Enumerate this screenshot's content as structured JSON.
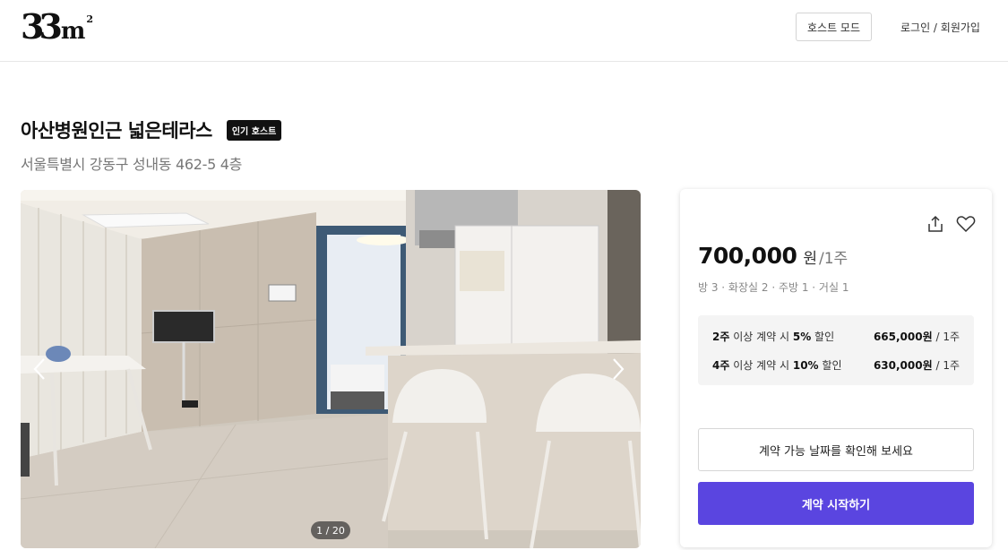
{
  "header": {
    "logo_number": "33",
    "logo_unit": "m",
    "logo_sup": "2",
    "host_mode_label": "호스트 모드",
    "login_label": "로그인 / 회원가입"
  },
  "listing": {
    "title": "아산병원인근 넓은테라스",
    "badge": "인기 호스트",
    "address": "서울특별시 강동구 성내동 462-5 4층"
  },
  "gallery": {
    "counter": "1 / 20",
    "current": 1,
    "total": 20
  },
  "booking": {
    "price": "700,000",
    "currency": "원",
    "period": "/1주",
    "specs": "방 3 · 화장실 2 · 주방 1 · 거실 1",
    "discounts": [
      {
        "weeks": "2주",
        "mid": " 이상 계약 시 ",
        "pct": "5%",
        "suffix": " 할인",
        "price": "665,000원",
        "per": " / 1주"
      },
      {
        "weeks": "4주",
        "mid": " 이상 계약 시 ",
        "pct": "10%",
        "suffix": " 할인",
        "price": "630,000원",
        "per": " / 1주"
      }
    ],
    "check_dates_label": "계약 가능 날짜를 확인해 보세요",
    "start_label": "계약 시작하기"
  },
  "colors": {
    "accent": "#5a45e0",
    "badge_bg": "#111111",
    "discount_bg": "#f4f4f4"
  },
  "icons": [
    "share-icon",
    "heart-icon",
    "chevron-left-icon",
    "chevron-right-icon"
  ]
}
